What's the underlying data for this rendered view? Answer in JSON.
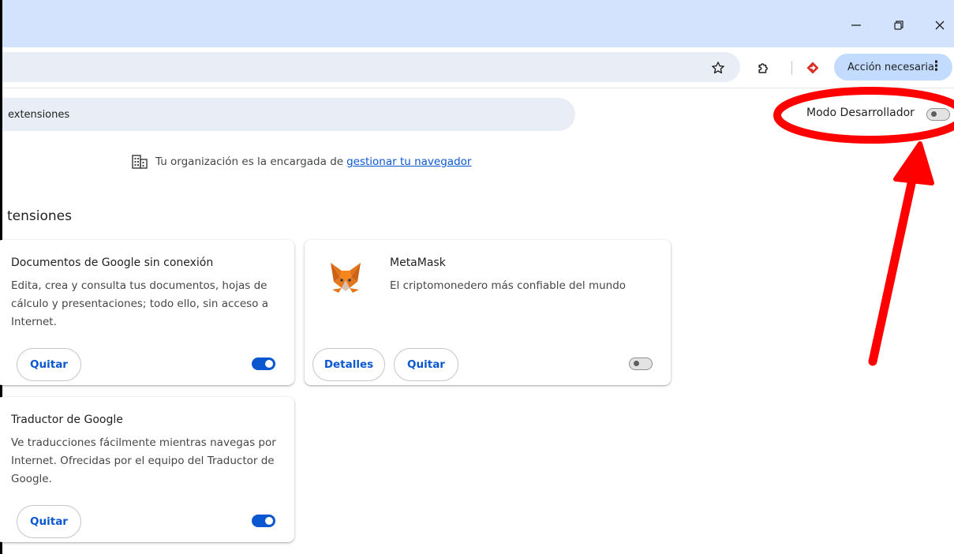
{
  "window": {
    "minimize_icon": "minimize-icon",
    "restore_icon": "restore-icon",
    "close_icon": "close-icon"
  },
  "toolbar": {
    "bookmark_icon": "star-icon",
    "extensions_icon": "puzzle-icon",
    "profile_icon": "extension-badge-icon",
    "action_label": "Acción necesaria",
    "menu_icon": "kebab-menu-icon"
  },
  "search": {
    "placeholder": "extensiones"
  },
  "dev_mode": {
    "label": "Modo Desarrollador",
    "enabled": false
  },
  "org_notice": {
    "text": "Tu organización es la encargada de",
    "link": "gestionar tu navegador"
  },
  "section_title": "tensiones",
  "extensions": [
    {
      "name": "Documentos de Google sin conexión",
      "description": "Edita, crea y consulta tus documentos, hojas de cálculo y presentaciones; todo ello, sin acceso a Internet.",
      "remove_label": "Quitar",
      "enabled": true
    },
    {
      "name": "MetaMask",
      "description": "El criptomonedero más confiable del mundo",
      "details_label": "Detalles",
      "remove_label": "Quitar",
      "enabled": false
    },
    {
      "name": "Traductor de Google",
      "description": "Ve traducciones fácilmente mientras navegas por Internet. Ofrecidas por el equipo del Traductor de Google.",
      "remove_label": "Quitar",
      "enabled": true
    }
  ],
  "colors": {
    "accent": "#0b57d0",
    "titlebar": "#d3e3fd",
    "annotation": "#ff0000"
  }
}
